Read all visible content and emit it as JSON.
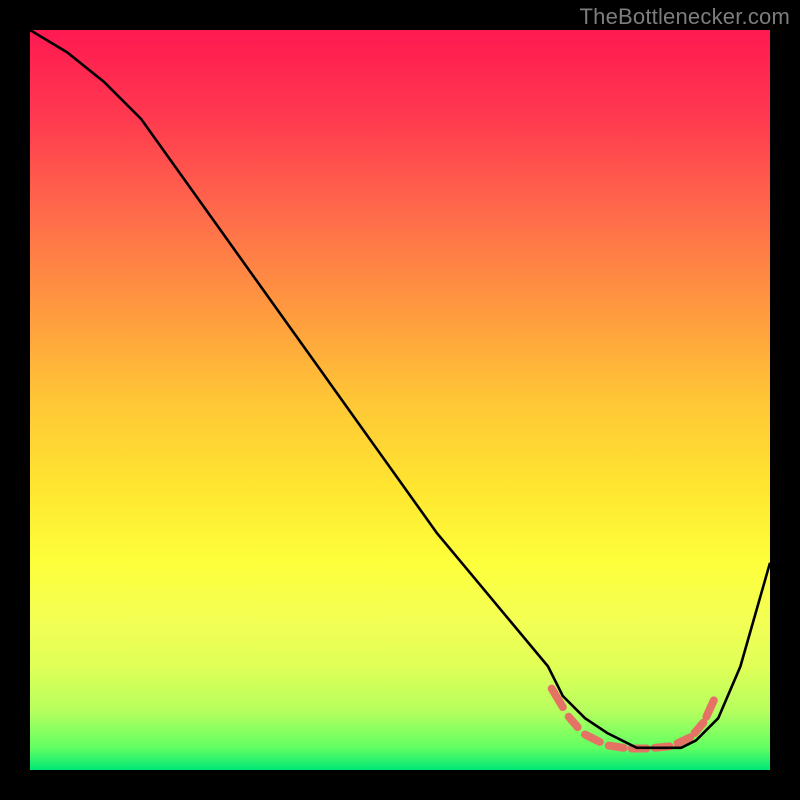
{
  "watermark": "TheBottlenecker.com",
  "chart_data": {
    "type": "line",
    "title": "",
    "xlabel": "",
    "ylabel": "",
    "xlim": [
      0,
      100
    ],
    "ylim": [
      0,
      100
    ],
    "grid": false,
    "curve": {
      "x": [
        0,
        5,
        10,
        15,
        20,
        25,
        30,
        35,
        40,
        45,
        50,
        55,
        60,
        65,
        70,
        72,
        75,
        78,
        80,
        82,
        85,
        88,
        90,
        93,
        96,
        100
      ],
      "y": [
        100,
        97,
        93,
        88,
        81,
        74,
        67,
        60,
        53,
        46,
        39,
        32,
        26,
        20,
        14,
        10,
        7,
        5,
        4,
        3,
        3,
        3,
        4,
        7,
        14,
        28
      ]
    },
    "coral_dash_segments": [
      {
        "x1": 70.5,
        "y1": 11.0,
        "x2": 72.0,
        "y2": 8.5
      },
      {
        "x1": 72.8,
        "y1": 7.2,
        "x2": 74.0,
        "y2": 5.8
      },
      {
        "x1": 75.0,
        "y1": 4.8,
        "x2": 77.0,
        "y2": 3.8
      },
      {
        "x1": 78.2,
        "y1": 3.3,
        "x2": 80.2,
        "y2": 3.0
      },
      {
        "x1": 81.3,
        "y1": 2.9,
        "x2": 83.3,
        "y2": 2.9
      },
      {
        "x1": 84.4,
        "y1": 3.0,
        "x2": 86.4,
        "y2": 3.2
      },
      {
        "x1": 87.5,
        "y1": 3.6,
        "x2": 89.2,
        "y2": 4.4
      },
      {
        "x1": 89.8,
        "y1": 5.0,
        "x2": 91.0,
        "y2": 6.4
      },
      {
        "x1": 91.4,
        "y1": 7.2,
        "x2": 92.4,
        "y2": 9.4
      }
    ],
    "colors": {
      "curve": "#000000",
      "dash": "#e57365"
    }
  }
}
